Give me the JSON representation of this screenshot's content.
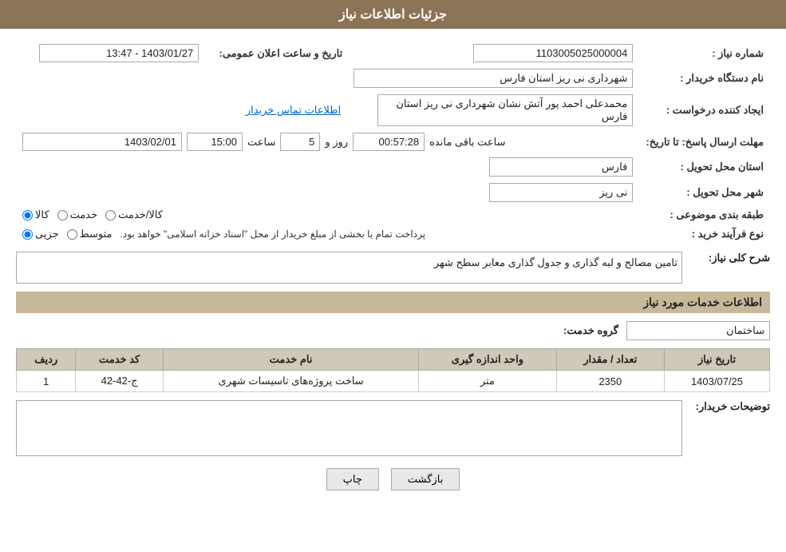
{
  "header": {
    "title": "جزئیات اطلاعات نیاز"
  },
  "fields": {
    "need_number_label": "شماره نیاز :",
    "need_number_value": "1103005025000004",
    "buyer_org_label": "نام دستگاه خریدار :",
    "buyer_org_value": "شهرداری نی ریز استان فارس",
    "requester_label": "ایجاد کننده درخواست :",
    "requester_value": "محمدعلی احمد پور آتش نشان شهرداری نی ریز استان فارس",
    "contact_link": "اطلاعات تماس خریدار",
    "send_date_label": "مهلت ارسال پاسخ: تا تاریخ:",
    "announce_date_label": "تاریخ و ساعت اعلان عمومی:",
    "announce_date_value": "1403/01/27 - 13:47",
    "deadline_date_value": "1403/02/01",
    "deadline_time_value": "15:00",
    "deadline_days_value": "5",
    "deadline_remaining_value": "00:57:28",
    "deadline_days_label": "روز و",
    "deadline_remaining_label": "ساعت باقی مانده",
    "delivery_province_label": "استان محل تحویل :",
    "delivery_province_value": "فارس",
    "delivery_city_label": "شهر محل تحویل :",
    "delivery_city_value": "نی ریز",
    "subject_label": "طبقه بندی موضوعی :",
    "subject_options": [
      "کالا",
      "خدمت",
      "کالا/خدمت"
    ],
    "subject_selected": "کالا",
    "process_label": "نوع فرآیند خرید :",
    "process_options": [
      "جزیی",
      "متوسط"
    ],
    "process_note": "پرداخت تمام یا بخشی از مبلغ خریدار از محل \"اسناد خزانه اسلامی\" خواهد بود.",
    "need_description_label": "شرح کلی نیاز:",
    "need_description_value": "تامین مصالح و لبه گذاری و جدول گذاری معابر سطح شهر",
    "services_section_label": "اطلاعات خدمات مورد نیاز",
    "group_service_label": "گروه خدمت:",
    "group_service_value": "ساختمان",
    "table_headers": {
      "row_num": "ردیف",
      "service_code": "کد خدمت",
      "service_name": "نام خدمت",
      "unit": "واحد اندازه گیری",
      "quantity": "تعداد / مقدار",
      "need_date": "تاریخ نیاز"
    },
    "table_rows": [
      {
        "row_num": "1",
        "service_code": "ج-42-42",
        "service_name": "ساخت پروژه‌های تاسیسات شهری",
        "unit": "متر",
        "quantity": "2350",
        "need_date": "1403/07/25"
      }
    ],
    "buyer_notes_label": "توضیحات خریدار:",
    "buyer_notes_value": ""
  },
  "buttons": {
    "print_label": "چاپ",
    "back_label": "بازگشت"
  }
}
